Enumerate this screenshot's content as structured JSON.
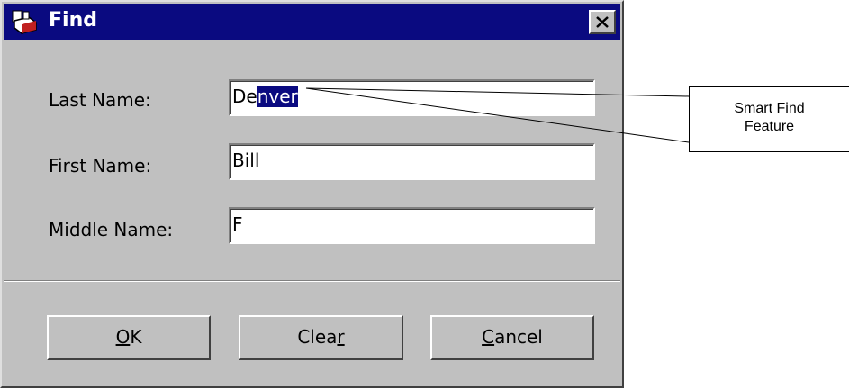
{
  "window": {
    "title": "Find",
    "icon": "find-app-icon",
    "close_icon": "close-icon"
  },
  "form": {
    "last_name": {
      "label": "Last Name:",
      "value_typed": "De",
      "value_autocomplete": "nver"
    },
    "first_name": {
      "label": "First Name:",
      "value": "Bill"
    },
    "middle_name": {
      "label": "Middle Name:",
      "value": "F"
    }
  },
  "buttons": {
    "ok": {
      "mnemonic": "O",
      "rest": "K"
    },
    "clear": {
      "before": "Clea",
      "mnemonic": "r"
    },
    "cancel": {
      "mnemonic": "C",
      "rest": "ancel"
    }
  },
  "callout": {
    "line1": "Smart Find",
    "line2": "Feature"
  },
  "colors": {
    "titlebar": "#0a0a80",
    "face": "#c0c0c0",
    "selection": "#0a0a80"
  }
}
